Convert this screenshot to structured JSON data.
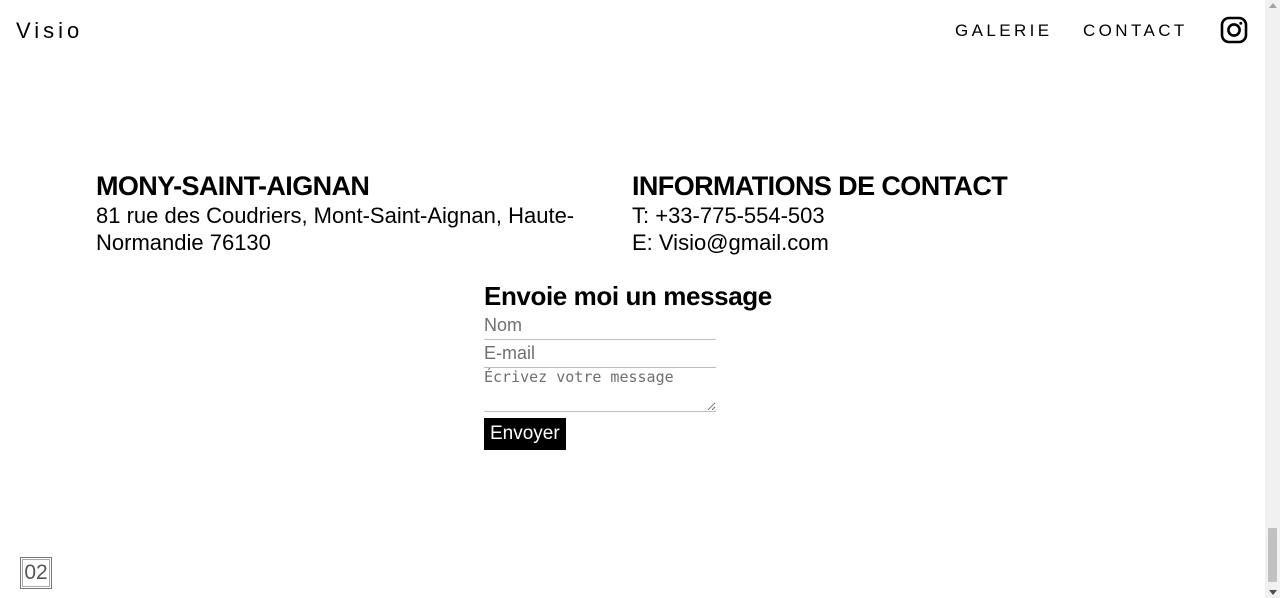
{
  "header": {
    "logo": "Visio",
    "nav": [
      "GALERIE",
      "CONTACT"
    ],
    "social_icon": "instagram-icon"
  },
  "location": {
    "title": "MONY-SAINT-AIGNAN",
    "address_line1": "81 rue des Coudriers, Mont-Saint-Aignan, Haute-",
    "address_line2": "Normandie 76130"
  },
  "contact_info": {
    "title": "INFORMATIONS DE CONTACT",
    "phone": "T: +33-775-554-503",
    "email": "E: Visio@gmail.com"
  },
  "form": {
    "title": "Envoie moi un message",
    "name_placeholder": "Nom",
    "email_placeholder": "E-mail",
    "message_placeholder": "Écrivez votre message",
    "submit_label": "Envoyer"
  },
  "page_counter": "02",
  "colors": {
    "text": "#000000",
    "button_bg": "#000000",
    "button_text": "#ffffff"
  }
}
